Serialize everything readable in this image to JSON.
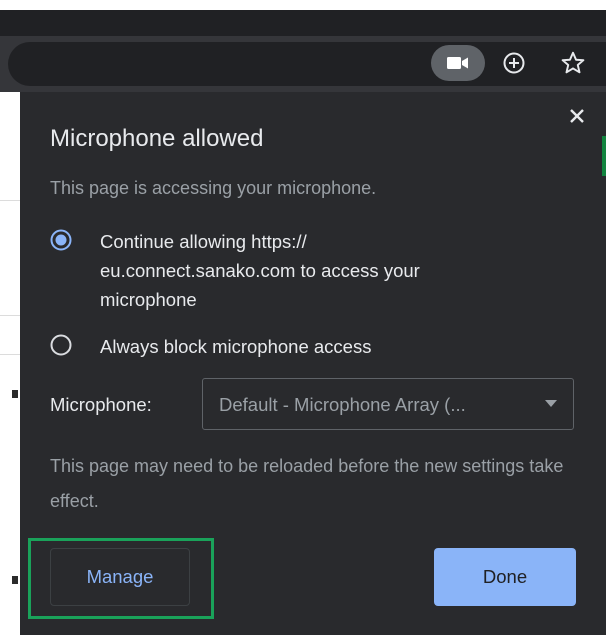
{
  "toolbar": {
    "camera_chip_icon": "video-camera-icon",
    "add_icon": "plus-circle-icon",
    "bookmark_icon": "star-icon"
  },
  "dialog": {
    "title": "Microphone allowed",
    "subtitle": "This page is accessing your microphone.",
    "options": [
      {
        "label": "Continue allowing https:// eu.connect.sanako.com to access your microphone",
        "selected": true
      },
      {
        "label": "Always block microphone access",
        "selected": false
      }
    ],
    "mic_label": "Microphone:",
    "mic_select_value": "Default - Microphone Array (...",
    "note": "This page may need to be reloaded before the new settings take effect.",
    "manage_label": "Manage",
    "done_label": "Done",
    "close_icon": "close-icon"
  },
  "colors": {
    "dialog_bg": "#292a2d",
    "accent_blue": "#8ab4f8",
    "highlight_green": "#1aa25a"
  }
}
